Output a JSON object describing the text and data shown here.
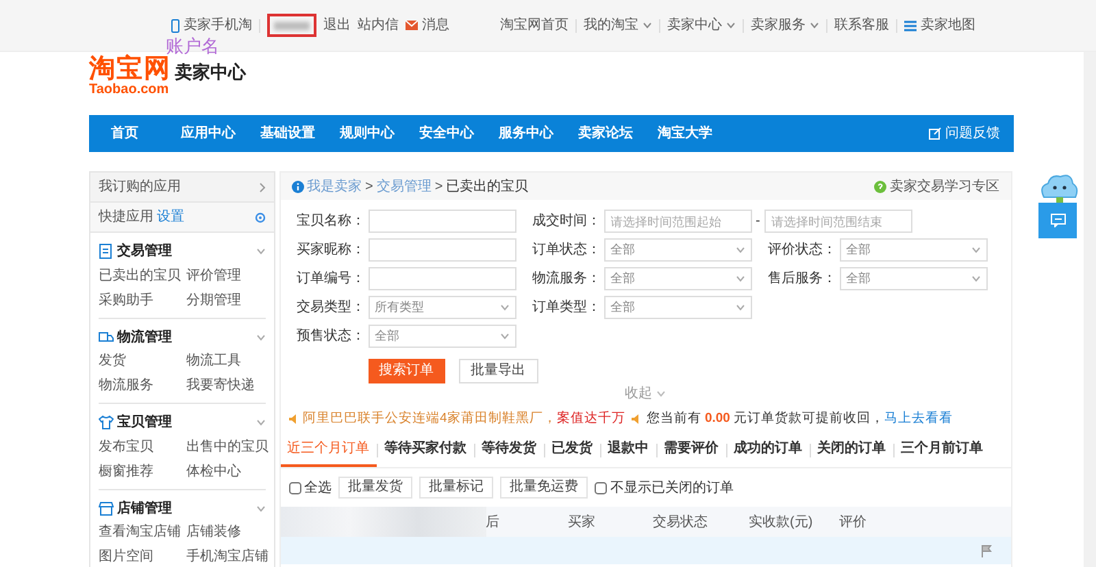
{
  "top_bar": {
    "left": [
      {
        "label": "卖家手机淘",
        "kind": "phone"
      },
      {
        "label": "退出",
        "kind": "account"
      },
      {
        "label": "站内信",
        "kind": "plain"
      },
      {
        "label": "消息",
        "kind": "mail"
      }
    ],
    "right": [
      {
        "label": "淘宝网首页",
        "kind": "link"
      },
      {
        "label": "我的淘宝",
        "kind": "dropdown"
      },
      {
        "label": "卖家中心",
        "kind": "dropdown"
      },
      {
        "label": "卖家服务",
        "kind": "dropdown"
      },
      {
        "label": "联系客服",
        "kind": "link"
      },
      {
        "label": "卖家地图",
        "kind": "menu"
      }
    ]
  },
  "annotation": "账户名",
  "logo": {
    "name": "淘宝网",
    "domain": "Taobao.com"
  },
  "site_title": "卖家中心",
  "nav": {
    "items": [
      {
        "label": "首页",
        "selected": false
      },
      {
        "label": "应用中心",
        "selected": false
      },
      {
        "label": "基础设置",
        "selected": false
      },
      {
        "label": "规则中心",
        "selected": false
      },
      {
        "label": "安全中心",
        "selected": false
      },
      {
        "label": "服务中心",
        "selected": false
      },
      {
        "label": "卖家论坛",
        "selected": false
      },
      {
        "label": "淘宝大学",
        "selected": false
      }
    ],
    "feedback": "问题反馈"
  },
  "sidebar": {
    "header": "我订购的应用",
    "quick": {
      "label": "快捷应用",
      "action": "设置"
    },
    "groups": [
      {
        "title": "交易管理",
        "kind": "document",
        "links": [
          "已卖出的宝贝",
          "评价管理",
          "采购助手",
          "分期管理"
        ]
      },
      {
        "title": "物流管理",
        "kind": "truck",
        "links": [
          "发货",
          "物流工具",
          "物流服务",
          "我要寄快递"
        ]
      },
      {
        "title": "宝贝管理",
        "kind": "shirt",
        "links": [
          "发布宝贝",
          "出售中的宝贝",
          "橱窗推荐",
          "体检中心"
        ]
      },
      {
        "title": "店铺管理",
        "kind": "shop",
        "links": [
          "查看淘宝店铺",
          "店铺装修",
          "图片空间",
          "手机淘宝店铺"
        ]
      }
    ]
  },
  "breadcrumb": [
    "我是卖家",
    "交易管理",
    "已卖出的宝贝"
  ],
  "breadcrumb_separator": ">",
  "help_link": "卖家交易学习专区",
  "filter_rows": [
    [
      {
        "label": "宝贝名称：",
        "kind": "text"
      },
      {
        "label": "成交时间：",
        "kind": "range",
        "placeholder": "请选择时间范围起始",
        "placeholder_end": "请选择时间范围结束",
        "separator": "-"
      }
    ],
    [
      {
        "label": "买家昵称：",
        "kind": "text"
      },
      {
        "label": "订单状态：",
        "kind": "select",
        "value": "全部"
      },
      {
        "label": "评价状态：",
        "kind": "select",
        "value": "全部"
      }
    ],
    [
      {
        "label": "订单编号：",
        "kind": "text"
      },
      {
        "label": "物流服务：",
        "kind": "select",
        "value": "全部"
      },
      {
        "label": "售后服务：",
        "kind": "select",
        "value": "全部"
      }
    ],
    [
      {
        "label": "交易类型：",
        "kind": "select",
        "value": "所有类型"
      },
      {
        "label": "订单类型：",
        "kind": "select",
        "value": "全部"
      }
    ],
    [
      {
        "label": "预售状态：",
        "kind": "select",
        "value": "全部"
      }
    ]
  ],
  "actions": [
    {
      "label": "搜索订单",
      "kind": "primary"
    },
    {
      "label": "批量导出",
      "kind": "secondary"
    }
  ],
  "collapse": "收起",
  "notices": [
    {
      "text": "阿里巴巴联手公安连端4家莆田制鞋黑厂，",
      "highlight": "案值达千万"
    },
    {
      "text": "您当前有 **0.00** 元订单货款可提前收回，",
      "link": "马上去看看"
    }
  ],
  "tabs": [
    {
      "label": "近三个月订单",
      "selected": true
    },
    {
      "label": "等待买家付款",
      "selected": false
    },
    {
      "label": "等待发货",
      "selected": false
    },
    {
      "label": "已发货",
      "selected": false
    },
    {
      "label": "退款中",
      "selected": false
    },
    {
      "label": "需要评价",
      "selected": false
    },
    {
      "label": "成功的订单",
      "selected": false
    },
    {
      "label": "关闭的订单",
      "selected": false
    },
    {
      "label": "三个月前订单",
      "selected": false
    }
  ],
  "toolbar": [
    {
      "kind": "checkbox",
      "label": "全选",
      "checked": false
    },
    {
      "kind": "button",
      "label": "批量发货"
    },
    {
      "kind": "button",
      "label": "批量标记"
    },
    {
      "kind": "button",
      "label": "批量免运费"
    },
    {
      "kind": "checkbox",
      "label": "不显示已关闭的订单",
      "checked": false
    }
  ],
  "table": {
    "columns": [
      "后",
      "买家",
      "交易状态",
      "实收款(元)",
      "评价"
    ]
  }
}
